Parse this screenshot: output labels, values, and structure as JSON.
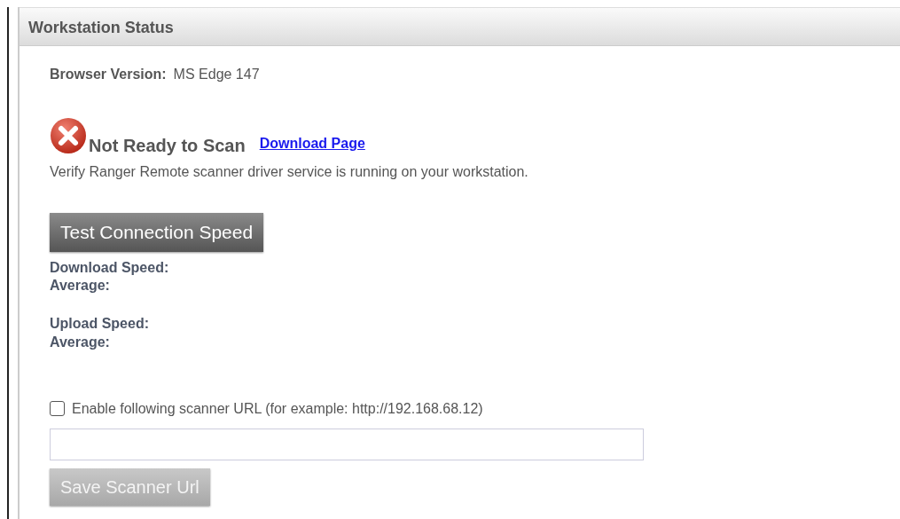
{
  "panel": {
    "title": "Workstation Status"
  },
  "browser_version": {
    "label": "Browser Version:",
    "value": "MS Edge 147"
  },
  "scan_status": {
    "ready": false,
    "text": "Not Ready to Scan",
    "link": "Download Page",
    "message": "Verify Ranger Remote scanner driver service is running on your workstation."
  },
  "test_button": {
    "label": "Test Connection Speed",
    "disabled": false
  },
  "speeds": [
    {
      "label": "Download Speed:",
      "average_label": "Average:"
    },
    {
      "label": "Upload Speed:",
      "average_label": "Average:"
    }
  ],
  "scanner_url": {
    "label": "Enable following scanner URL (for example: http://192.168.68.12)",
    "checked": false
  },
  "save_button": {
    "label": "Save Scanner Url",
    "disabled": true
  }
}
